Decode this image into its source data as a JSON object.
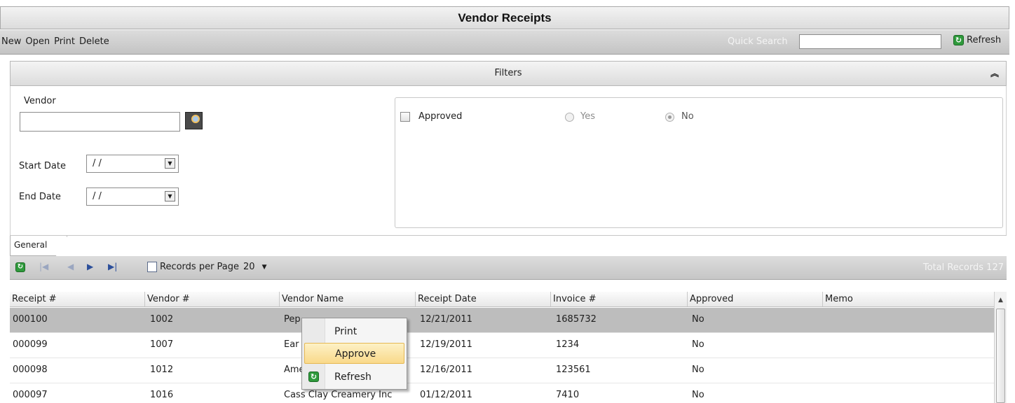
{
  "window": {
    "title": "Vendor Receipts"
  },
  "toolbar": {
    "menu": [
      "New",
      "Open",
      "Print",
      "Delete"
    ],
    "quick_search_label": "Quick Search",
    "quick_search_value": "",
    "refresh_label": "Refresh"
  },
  "filters": {
    "header": "Filters",
    "vendor_label": "Vendor",
    "vendor_value": "",
    "start_date_label": "Start Date",
    "start_date_value": "/ /",
    "end_date_label": "End Date",
    "end_date_value": "/ /",
    "approved_label": "Approved",
    "approved_checked": false,
    "yes_label": "Yes",
    "no_label": "No",
    "selected_option": "No"
  },
  "tabs": {
    "general": "General"
  },
  "pager": {
    "records_per_page_label": "Records per Page",
    "records_per_page_value": "20",
    "total_records_label": "Total Records",
    "total_records_value": "127"
  },
  "grid": {
    "columns": [
      "Receipt #",
      "Vendor #",
      "Vendor Name",
      "Receipt Date",
      "Invoice #",
      "Approved",
      "Memo"
    ],
    "rows": [
      [
        "000100",
        "1002",
        "Pep",
        "12/21/2011",
        "1685732",
        "No",
        ""
      ],
      [
        "000099",
        "1007",
        "Ear",
        "12/19/2011",
        "1234",
        "No",
        ""
      ],
      [
        "000098",
        "1012",
        "Ame",
        "12/16/2011",
        "123561",
        "No",
        ""
      ],
      [
        "000097",
        "1016",
        "Cass Clay Creamery Inc",
        "01/12/2011",
        "7410",
        "No",
        ""
      ]
    ]
  },
  "context_menu": {
    "items": [
      "Print",
      "Approve",
      "Refresh"
    ],
    "highlighted": "Approve"
  }
}
